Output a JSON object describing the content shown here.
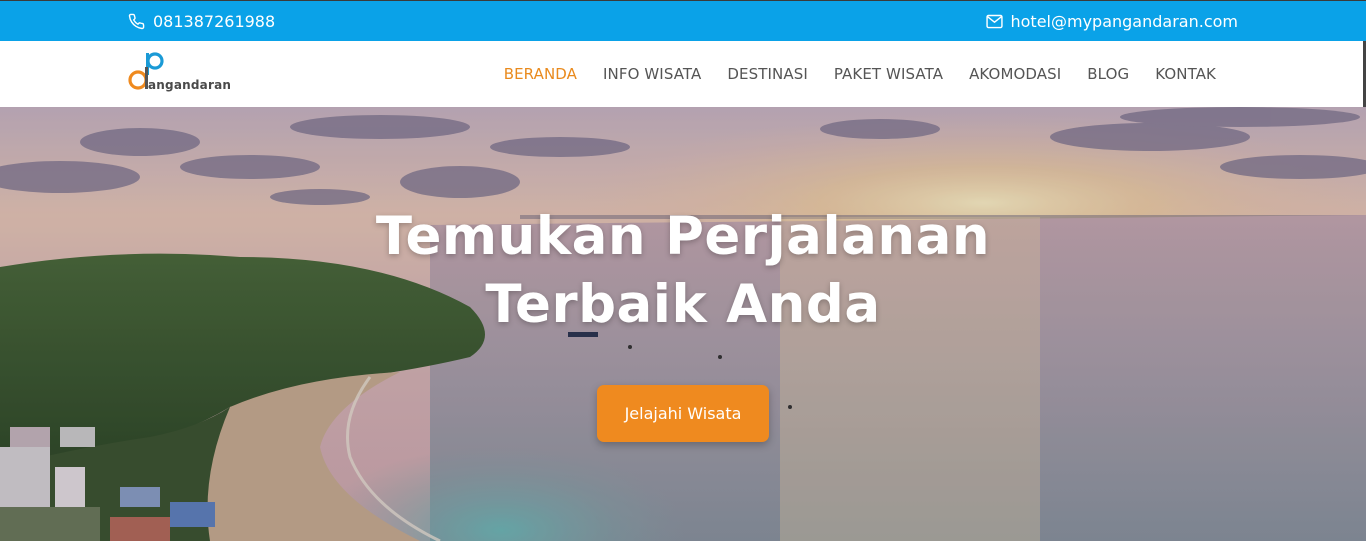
{
  "topbar": {
    "phone": "081387261988",
    "email": "hotel@mypangandaran.com",
    "phone_icon": "phone-icon",
    "email_icon": "envelope-icon",
    "background_color": "#0aa2e8"
  },
  "logo": {
    "text": "angandaran",
    "icon": "pangandaran-logo-mark"
  },
  "nav": {
    "items": [
      {
        "label": "BERANDA",
        "active": true
      },
      {
        "label": "INFO WISATA",
        "active": false
      },
      {
        "label": "DESTINASI",
        "active": false
      },
      {
        "label": "PAKET WISATA",
        "active": false
      },
      {
        "label": "AKOMODASI",
        "active": false
      },
      {
        "label": "BLOG",
        "active": false
      },
      {
        "label": "KONTAK",
        "active": false
      }
    ],
    "active_color": "#e98a1d"
  },
  "hero": {
    "title_line1": "Temukan Perjalanan",
    "title_line2": "Terbaik Anda",
    "cta_label": "Jelajahi Wisata",
    "cta_color": "#ef8a1f"
  }
}
